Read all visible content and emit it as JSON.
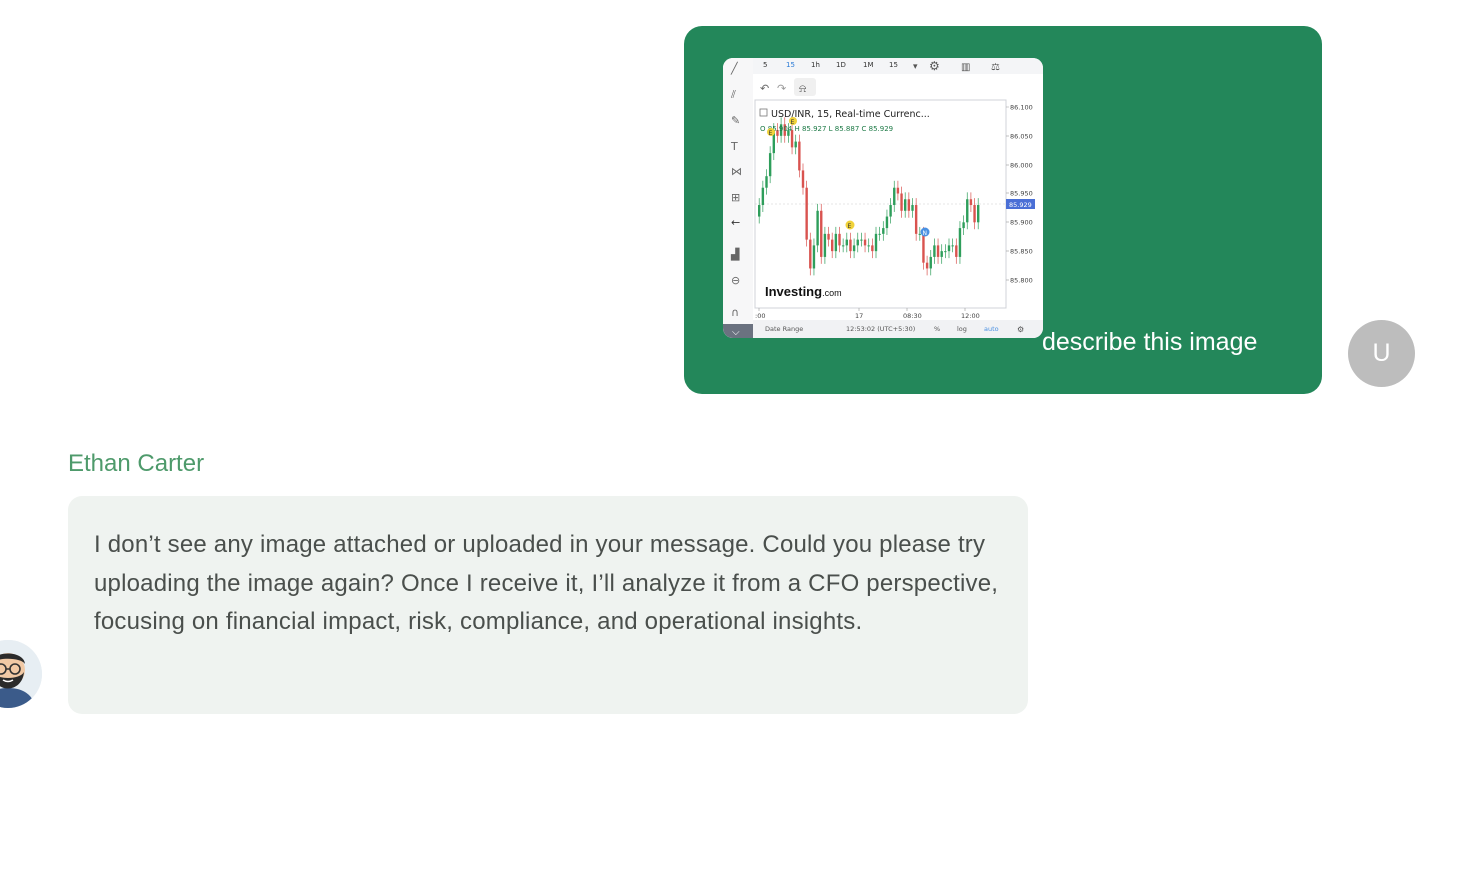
{
  "user_message": {
    "text": "describe this image",
    "avatar_initial": "U",
    "attachment": {
      "alt": "Investing.com USD/INR candlestick chart screenshot",
      "toolbar_intervals": [
        "5",
        "15",
        "1h",
        "1D",
        "1M",
        "15"
      ],
      "symbol_title": "USD/INR, 15, Real-time Currenc...",
      "ohlc": "O 85.904  H 85.927  L 85.887  C 85.929",
      "price_ticks": [
        "86.100",
        "86.050",
        "86.000",
        "85.950",
        "85.900",
        "85.850",
        "85.800"
      ],
      "current_price": "85.929",
      "time_ticks": [
        ":00",
        "17",
        "08:30",
        "12:00"
      ],
      "brand": "Investing",
      "brand_suffix": ".com",
      "footer": {
        "date_range": "Date Range",
        "time": "12:53:02 (UTC+5:30)",
        "percent": "%",
        "log": "log",
        "auto": "auto"
      }
    }
  },
  "assistant_message": {
    "name": "Ethan Carter",
    "text": "I don’t see any image attached or uploaded in your message. Could you please try uploading the image again? Once I receive it, I’ll analyze it from a CFO perspective, focusing on financial impact, risk, compliance, and operational insights."
  },
  "colors": {
    "user_bubble": "#23875a",
    "assistant_bubble": "#eff3f0",
    "assistant_name": "#4e9a6b",
    "user_avatar": "#bdbdbd",
    "candle_up": "#2e9e5b",
    "candle_down": "#d9534f"
  }
}
